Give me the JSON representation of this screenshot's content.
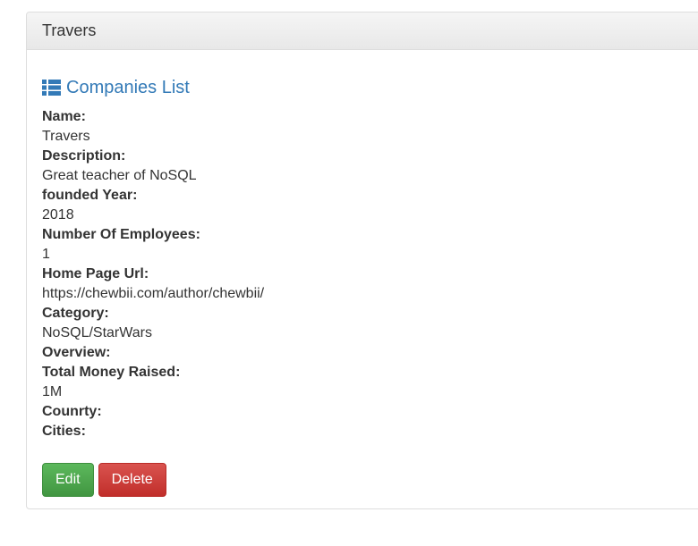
{
  "panel": {
    "title": "Travers"
  },
  "list_link": {
    "label": "Companies List",
    "icon": "list-icon",
    "color": "#337ab7"
  },
  "fields": [
    {
      "label": "Name:",
      "value": "Travers"
    },
    {
      "label": "Description:",
      "value": "Great teacher of NoSQL"
    },
    {
      "label": "founded Year:",
      "value": "2018"
    },
    {
      "label": "Number Of Employees:",
      "value": "1"
    },
    {
      "label": "Home Page Url:",
      "value": "https://chewbii.com/author/chewbii/"
    },
    {
      "label": "Category:",
      "value": "NoSQL/StarWars"
    },
    {
      "label": "Overview:",
      "value": ""
    },
    {
      "label": "Total Money Raised:",
      "value": "1M"
    },
    {
      "label": "Counrty:",
      "value": ""
    },
    {
      "label": "Cities:",
      "value": ""
    }
  ],
  "actions": {
    "edit_label": "Edit",
    "delete_label": "Delete",
    "edit_color": "#5cb85c",
    "delete_color": "#d9534f"
  }
}
